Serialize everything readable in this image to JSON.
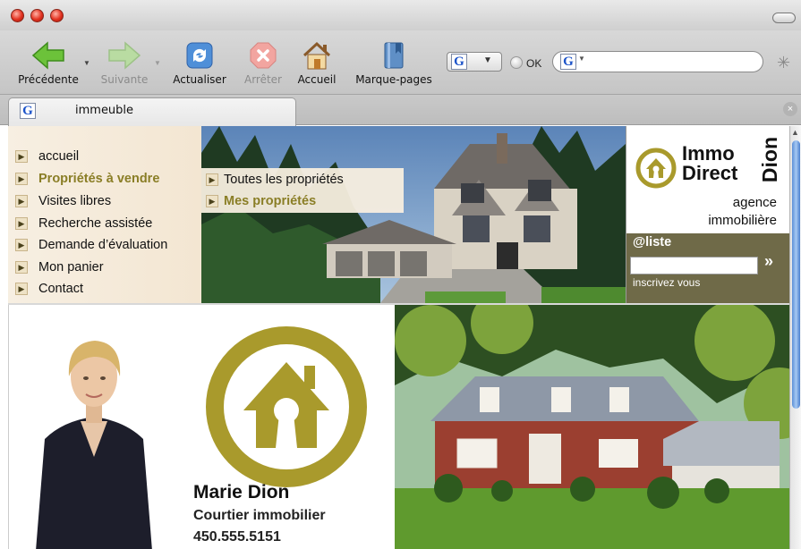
{
  "browser": {
    "toolbar": {
      "back_label": "Précédente",
      "forward_label": "Suivante",
      "reload_label": "Actualiser",
      "stop_label": "Arrêter",
      "home_label": "Accueil",
      "bookmarks_label": "Marque-pages",
      "search_engine_icon": "G",
      "ok_label": "OK",
      "search_input_value": ""
    },
    "tab": {
      "title": "immeuble",
      "icon": "G"
    }
  },
  "site": {
    "nav": [
      {
        "label": "accueil"
      },
      {
        "label": "Propriétés à vendre"
      },
      {
        "label": "Visites libres"
      },
      {
        "label": "Recherche assistée"
      },
      {
        "label": "Demande d’évaluation"
      },
      {
        "label": "Mon panier"
      },
      {
        "label": "Contact"
      }
    ],
    "submenu": [
      {
        "label": "Toutes les propriétés"
      },
      {
        "label": "Mes propriétés"
      }
    ],
    "brand": {
      "line1": "Immo",
      "line2": "Direct",
      "vertical": "Dion",
      "sub1": "agence",
      "sub2": "immobilière"
    },
    "newsletter": {
      "title": "@liste",
      "input_value": "",
      "go": "»",
      "note": "inscrivez vous"
    },
    "agent": {
      "name": "Marie Dion",
      "role": "Courtier immobilier",
      "phone": "450.555.5151"
    },
    "colors": {
      "olive": "#a99a2c",
      "active_link": "#8a7e26",
      "newsletter_bg": "#6f6a48"
    }
  }
}
